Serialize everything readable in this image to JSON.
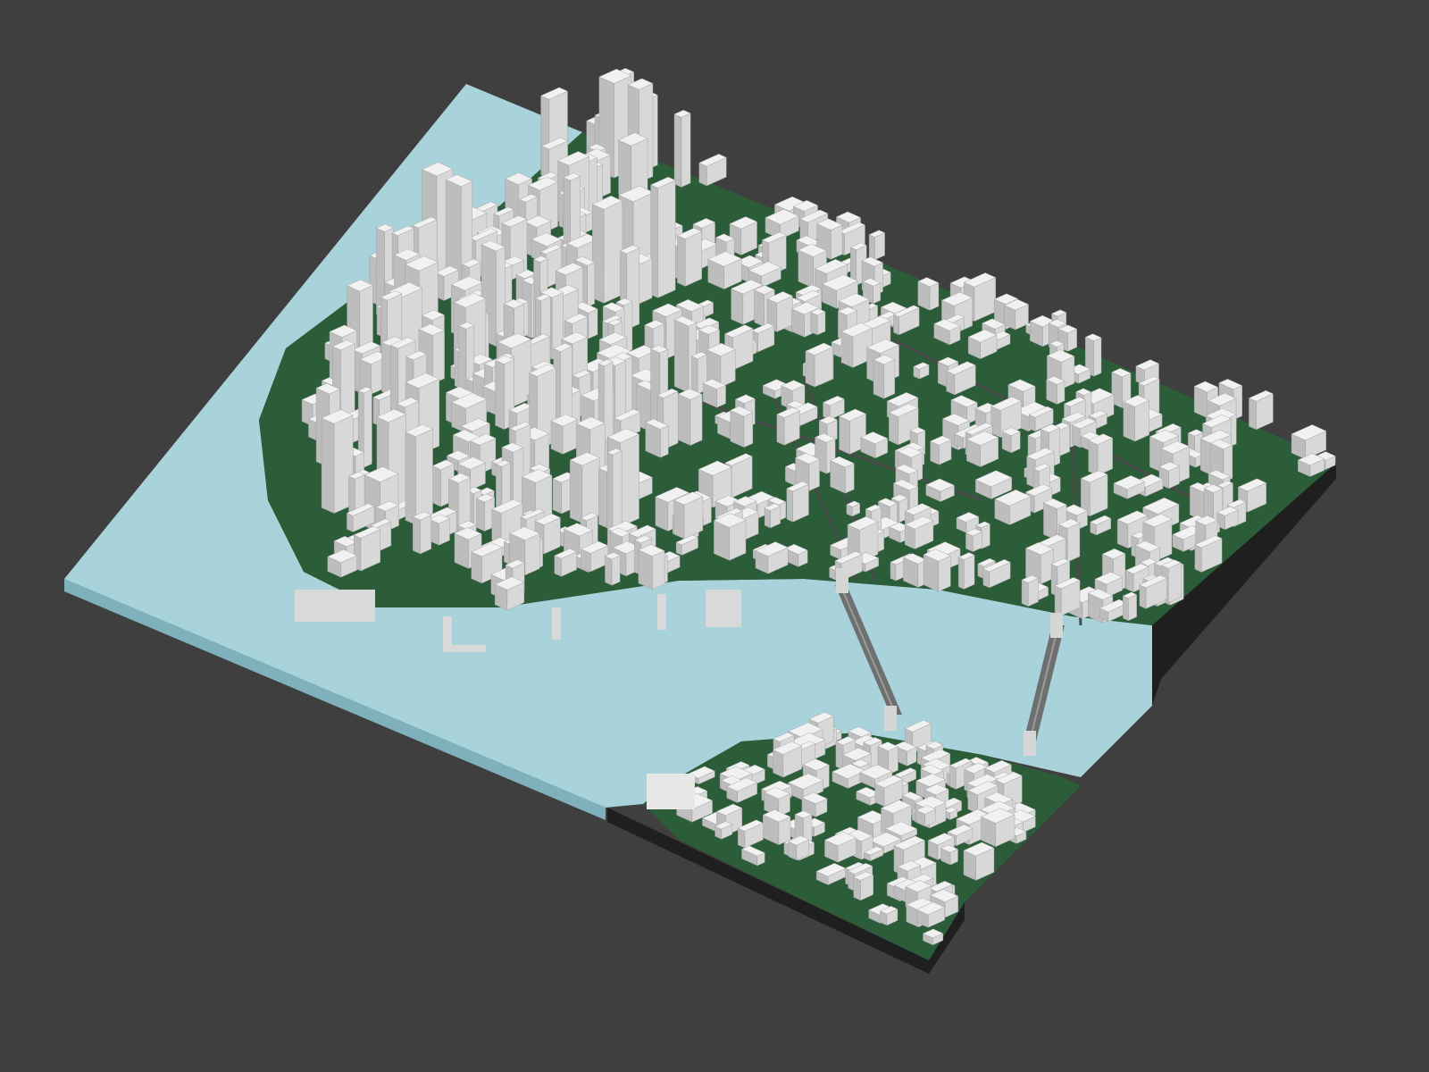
{
  "scene": {
    "background_color": "#3f3f3f",
    "water_color": "#a9d3db",
    "water_edge_color": "#7fb1bd",
    "land_base_color": "#1f1f1f",
    "park_color": "#2f6d3e",
    "tree_color": "#3e8a52",
    "building_light": "#e9e9e9",
    "building_mid": "#cfcfcf",
    "building_dark": "#a8a8a8",
    "road_color": "#4a4a4a"
  },
  "elements": {
    "water": "water",
    "manhattan": "manhattan-landmass",
    "brooklyn": "brooklyn-landmass",
    "bridges": [
      "brooklyn-bridge",
      "manhattan-bridge"
    ]
  }
}
